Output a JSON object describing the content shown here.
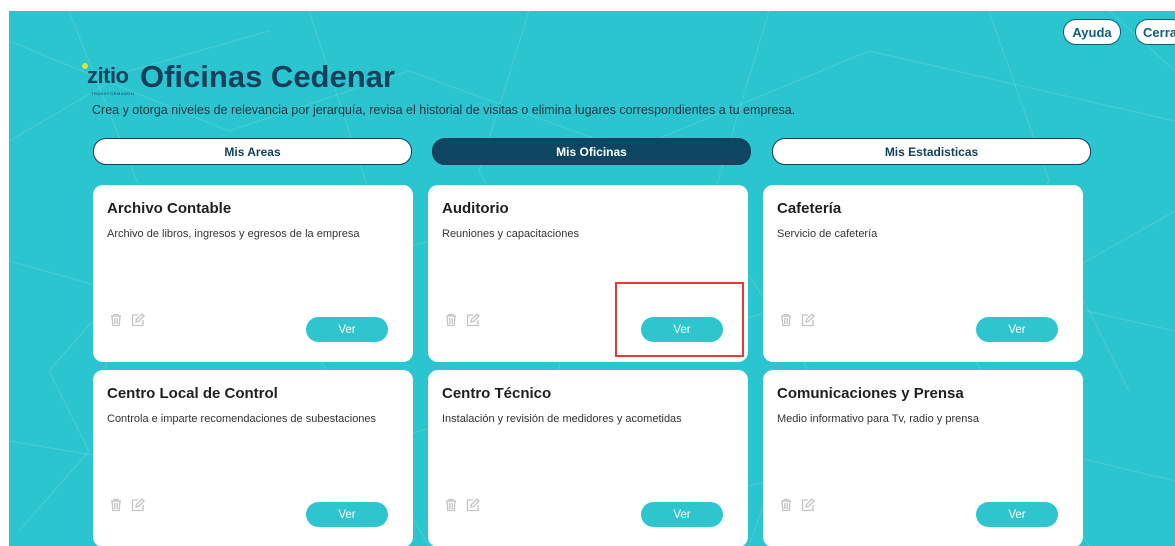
{
  "header": {
    "help_label": "Ayuda",
    "close_label": "Cerra",
    "logo_text": "zitio",
    "logo_tagline": "TRANSFORMANDO",
    "title": "Oficinas Cedenar",
    "subtitle": "Crea y otorga niveles de relevancia por jerarquía, revisa el historial de visitas o elimina lugares correspondientes a tu empresa."
  },
  "tabs": [
    {
      "label": "Mis Areas",
      "active": false
    },
    {
      "label": "Mis Oficinas",
      "active": true
    },
    {
      "label": "Mis Estadisticas",
      "active": false
    }
  ],
  "cards": [
    {
      "title": "Archivo Contable",
      "description": "Archivo de libros, ingresos y egresos de la empresa",
      "button_label": "Ver"
    },
    {
      "title": "Auditorio",
      "description": "Reuniones y capacitaciones",
      "button_label": "Ver"
    },
    {
      "title": "Cafetería",
      "description": "Servicio de cafetería",
      "button_label": "Ver"
    },
    {
      "title": "Centro Local de Control",
      "description": "Controla e imparte recomendaciones de subestaciones",
      "button_label": "Ver"
    },
    {
      "title": "Centro Técnico",
      "description": "Instalación y revisión de medidores y acometidas",
      "button_label": "Ver"
    },
    {
      "title": "Comunicaciones y Prensa",
      "description": "Medio informativo para Tv, radio y prensa",
      "button_label": "Ver"
    }
  ],
  "icons": {
    "delete": "trash-icon",
    "edit": "edit-icon"
  },
  "colors": {
    "background": "#2bc5cf",
    "primary": "#0e4562",
    "accent": "#2ec5cf",
    "highlight": "#e53935"
  }
}
